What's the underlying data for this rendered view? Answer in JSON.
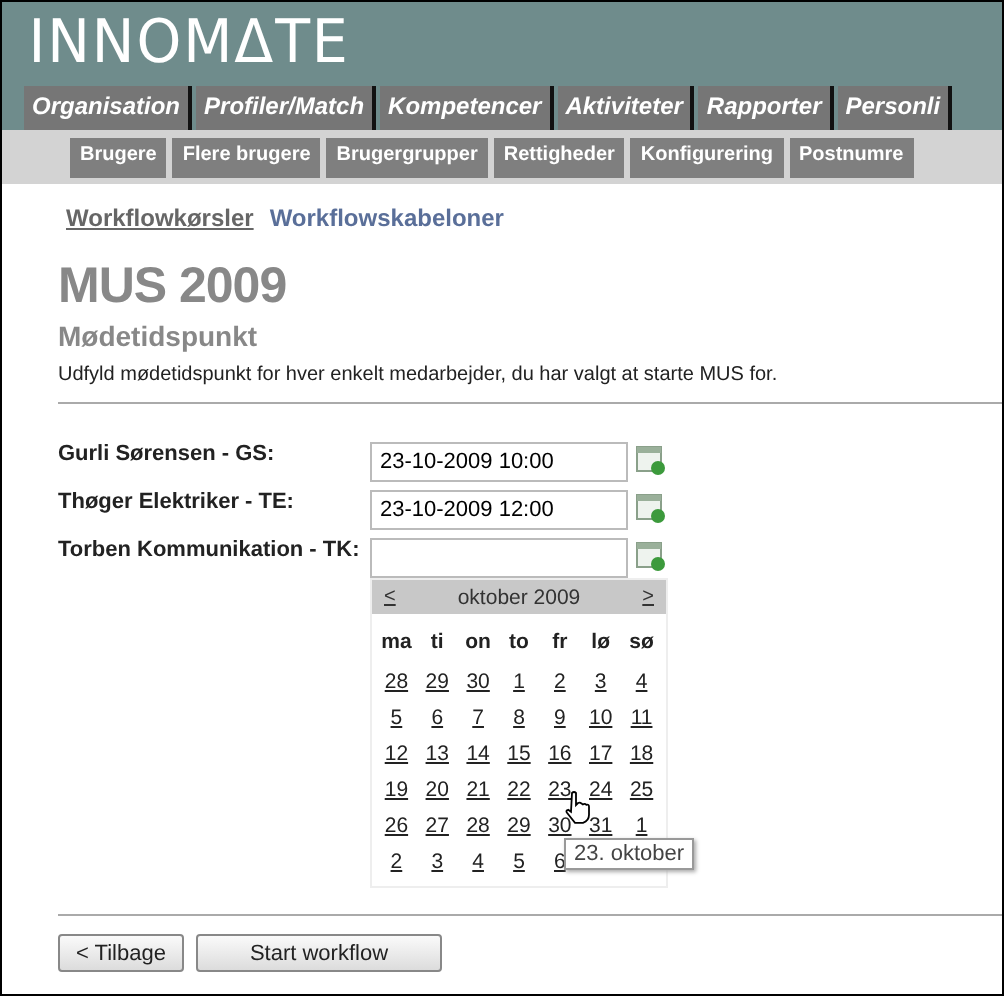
{
  "logo": "INNOMΔTE",
  "tabs": [
    "Organisation",
    "Profiler/Match",
    "Kompetencer",
    "Aktiviteter",
    "Rapporter",
    "Personli"
  ],
  "subtabs": [
    "Brugere",
    "Flere brugere",
    "Brugergrupper",
    "Rettigheder",
    "Konfigurering",
    "Postnumre"
  ],
  "links": [
    {
      "label": "Workflowkørsler",
      "selected": true
    },
    {
      "label": "Workflowskabeloner",
      "selected": false
    }
  ],
  "title": "MUS 2009",
  "subtitle": "Mødetidspunkt",
  "description": "Udfyld mødetidspunkt for hver enkelt medarbejder, du har valgt at starte MUS for.",
  "employees": [
    {
      "label": "Gurli Sørensen - GS:",
      "value": "23-10-2009 10:00"
    },
    {
      "label": "Thøger Elektriker - TE:",
      "value": "23-10-2009 12:00"
    },
    {
      "label": "Torben Kommunikation - TK:"
    }
  ],
  "calendar": {
    "prev": "<",
    "month": "oktober 2009",
    "next": ">",
    "weekdays": [
      "ma",
      "ti",
      "on",
      "to",
      "fr",
      "lø",
      "sø"
    ],
    "weeks": [
      [
        "28",
        "29",
        "30",
        "1",
        "2",
        "3",
        "4"
      ],
      [
        "5",
        "6",
        "7",
        "8",
        "9",
        "10",
        "11"
      ],
      [
        "12",
        "13",
        "14",
        "15",
        "16",
        "17",
        "18"
      ],
      [
        "19",
        "20",
        "21",
        "22",
        "23",
        "24",
        "25"
      ],
      [
        "26",
        "27",
        "28",
        "29",
        "30",
        "31",
        "1"
      ],
      [
        "2",
        "3",
        "4",
        "5",
        "6"
      ]
    ],
    "tooltip": "23. oktober"
  },
  "buttons": [
    {
      "label": "< Tilbage",
      "kind": "back"
    },
    {
      "label": "Start workflow",
      "kind": "primary"
    }
  ]
}
